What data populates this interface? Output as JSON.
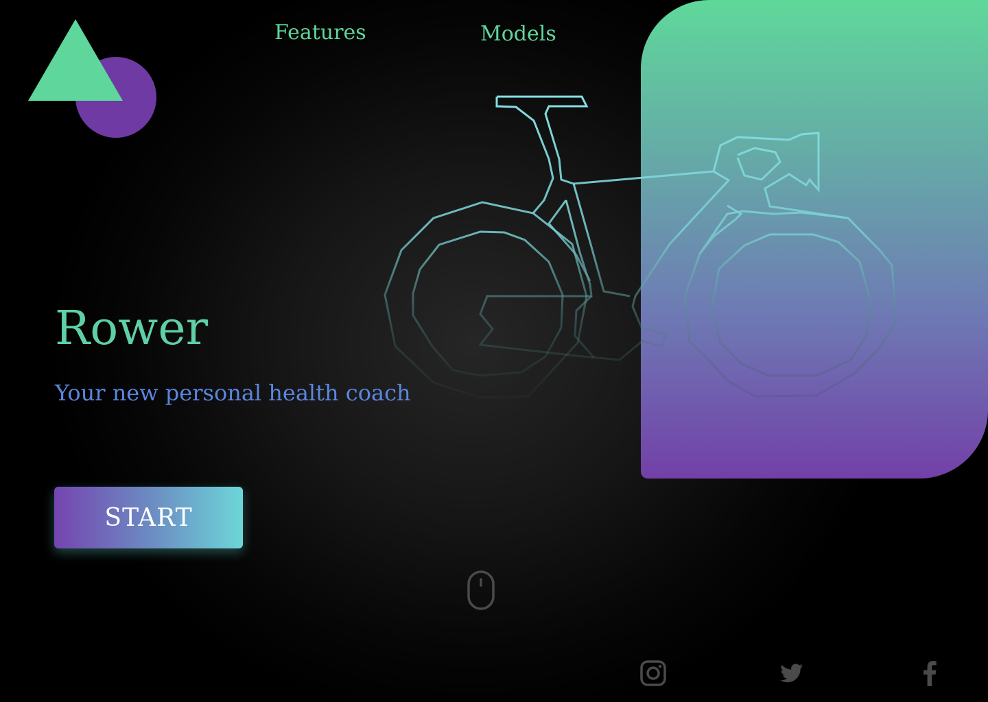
{
  "nav": {
    "features_label": "Features",
    "models_label": "Models"
  },
  "hero": {
    "title": "Rower",
    "subtitle": "Your new personal health coach",
    "cta_label": "START"
  },
  "icons": {
    "logo": "logo-triangle-circle",
    "illustration": "bicycle-outline",
    "scroll": "mouse-scroll-icon",
    "social": [
      "instagram-icon",
      "twitter-icon",
      "facebook-icon"
    ]
  },
  "colors": {
    "background": "#000000",
    "accent_green": "#5fd69b",
    "accent_purple": "#6f3aa4",
    "subtitle_blue": "#5b86e0",
    "bike_stroke": "#7fd8dc",
    "icon_gray": "#4a4a4a"
  }
}
